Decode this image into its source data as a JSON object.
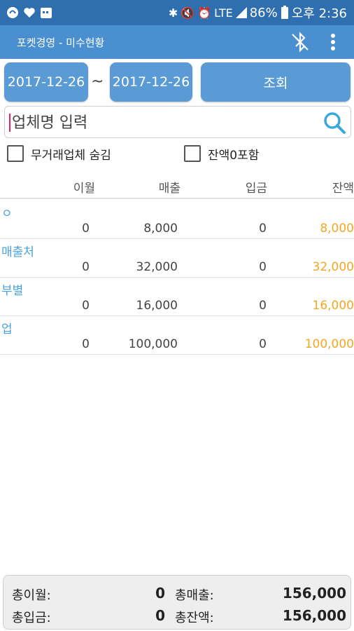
{
  "status_bar": {
    "battery": "86%",
    "time": "오후 2:36",
    "network": "LTE"
  },
  "app_bar": {
    "title": "포켓경영 - 미수현황"
  },
  "filters": {
    "from_date": "2017-12-26",
    "separator": "~",
    "to_date": "2017-12-26",
    "query_label": "조회"
  },
  "search": {
    "placeholder": "업체명 입력",
    "value": ""
  },
  "options": {
    "hide_inactive_label": "무거래업체 숨김",
    "include_zero_label": "잔액0포함"
  },
  "table": {
    "headers": {
      "prev": "이월",
      "sales": "매출",
      "deposit": "입금",
      "balance": "잔액"
    },
    "rows": [
      {
        "name": "ㅇ",
        "prev": "0",
        "sales": "8,000",
        "deposit": "0",
        "balance": "8,000"
      },
      {
        "name": "매출처",
        "prev": "0",
        "sales": "32,000",
        "deposit": "0",
        "balance": "32,000"
      },
      {
        "name": "부별",
        "prev": "0",
        "sales": "16,000",
        "deposit": "0",
        "balance": "16,000"
      },
      {
        "name": "업",
        "prev": "0",
        "sales": "100,000",
        "deposit": "0",
        "balance": "100,000"
      }
    ]
  },
  "totals": {
    "prev_label": "총이월:",
    "prev_value": "0",
    "sales_label": "총매출:",
    "sales_value": "156,000",
    "deposit_label": "총입금:",
    "deposit_value": "0",
    "balance_label": "총잔액:",
    "balance_value": "156,000"
  },
  "colors": {
    "status_bar": "#2f6fb0",
    "app_bar": "#4a8fd0",
    "button": "#5b9bd5",
    "name_text": "#4aa3df",
    "balance_text": "#f5a623"
  }
}
